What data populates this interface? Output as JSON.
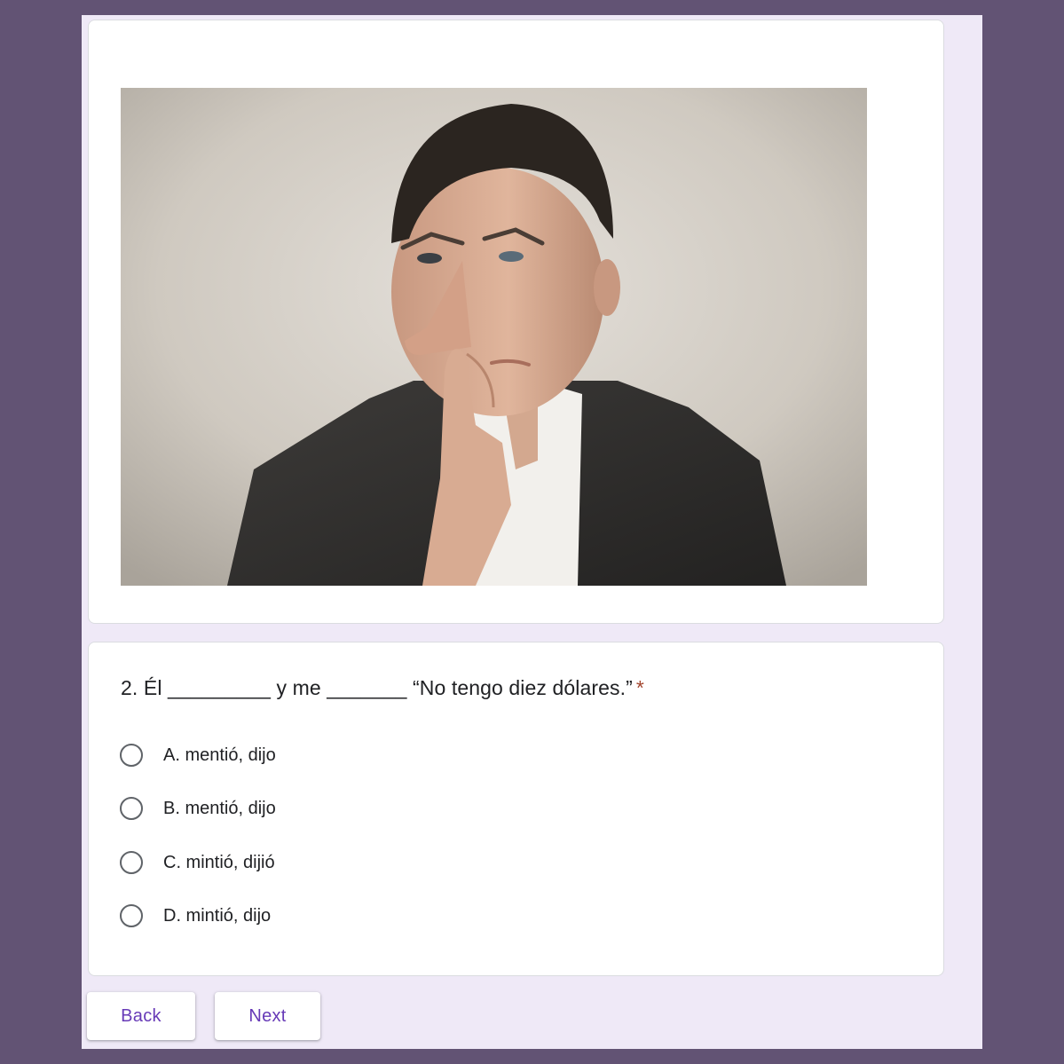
{
  "question": {
    "title": "2. Él _________ y me _______ “No tengo diez dólares.”",
    "required_marker": "*",
    "options": [
      {
        "label": "A. mentió, dijo",
        "selected": false
      },
      {
        "label": "B. mentió, dijo",
        "selected": false
      },
      {
        "label": "C. mintió, dijió",
        "selected": false
      },
      {
        "label": "D. mintió, dijo",
        "selected": false
      }
    ]
  },
  "buttons": {
    "back_label": "Back",
    "next_label": "Next"
  },
  "colors": {
    "page_background": "#625374",
    "form_background": "#efe9f7",
    "accent": "#673ab7",
    "required": "#a3462f"
  }
}
